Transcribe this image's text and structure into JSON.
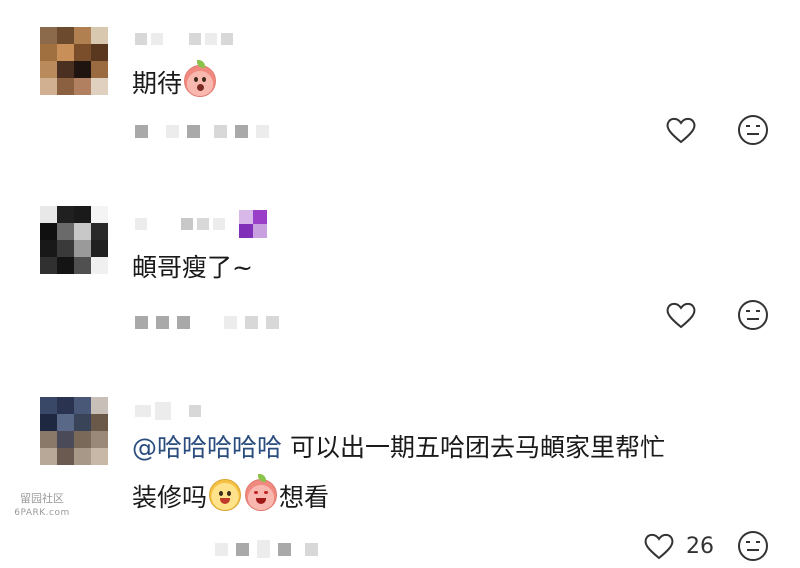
{
  "comments": [
    {
      "text": "期待",
      "likes": "",
      "emoji_after_text": [
        "peach-shocked-emoji"
      ]
    },
    {
      "text": "頔哥瘦了~",
      "likes": "",
      "emoji_after_text": []
    },
    {
      "mention": "@哈哈哈哈哈",
      "text_line1": " 可以出一期五哈团去马頔家里帮忙",
      "text_line2_a": "装修吗",
      "text_line2_b": "想看",
      "likes": "26",
      "emoji_after_text": [
        "yellow-monkey-emoji",
        "peach-crying-emoji"
      ]
    }
  ],
  "watermark": {
    "line1": "留园社区",
    "line2": "6PARK.com"
  },
  "icons": {
    "like": "heart-outline-icon",
    "react": "neutral-face-icon"
  },
  "colors": {
    "mention": "#2a4d7e",
    "text": "#1a1a1a",
    "icon": "#333333"
  }
}
